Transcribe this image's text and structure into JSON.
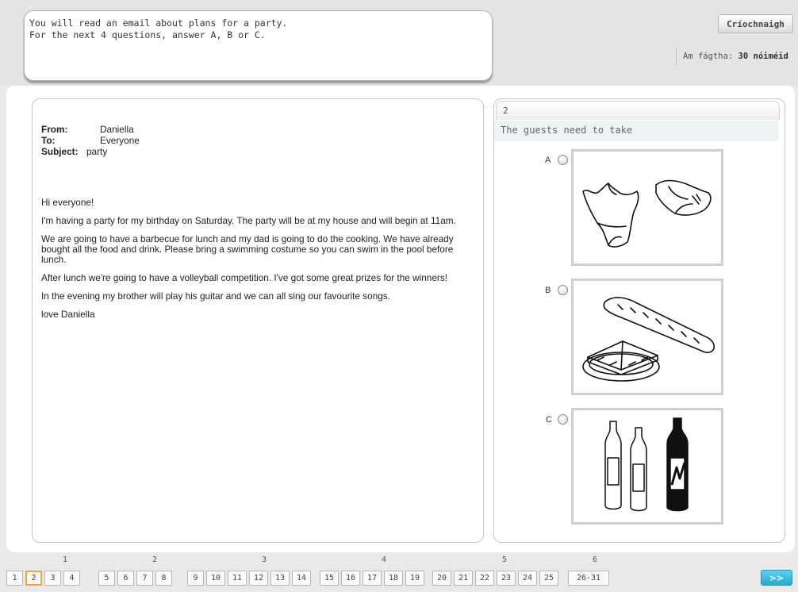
{
  "instructions": {
    "line1": "You will read an email about plans for a party.",
    "line2": "For the next 4 questions, answer A, B or C."
  },
  "header": {
    "finish_label": "Críochnaigh",
    "timer_label": "Am fágtha:",
    "timer_value": "30 nóiméid"
  },
  "email": {
    "from_label": "From:",
    "from_value": "Daniella",
    "to_label": "To:",
    "to_value": "Everyone",
    "subject_label": "Subject:",
    "subject_value": "party",
    "greeting": "Hi everyone!",
    "para1": "I'm having a party for my birthday on Saturday. The party will be at my house and will begin at 11am.",
    "para2": "We are going to have a barbecue for lunch and my dad is going to do the cooking. We have already bought all the food and drink. Please bring a swimming costume so you can swim in the pool before lunch.",
    "para3": "After lunch we're going to have a volleyball competition. I've got some great prizes for the winners!",
    "para4": "In the evening my brother will play his guitar and we can all sing our favourite songs.",
    "signoff": "love Daniella"
  },
  "question": {
    "number": "2",
    "stem": "The guests need to take",
    "options": [
      {
        "label": "A",
        "image": "swimming-costume"
      },
      {
        "label": "B",
        "image": "sandwiches-and-baguette"
      },
      {
        "label": "C",
        "image": "drink-bottles"
      }
    ]
  },
  "navigation": {
    "sections": [
      "1",
      "2",
      "3",
      "4",
      "5",
      "6"
    ],
    "buttons": [
      "1",
      "2",
      "3",
      "4",
      "5",
      "6",
      "7",
      "8",
      "9",
      "10",
      "11",
      "12",
      "13",
      "14",
      "15",
      "16",
      "17",
      "18",
      "19",
      "20",
      "21",
      "22",
      "23",
      "24",
      "25",
      "26-31"
    ],
    "current": "2",
    "next_label": ">>"
  },
  "colors": {
    "current_outline": "#f0a542",
    "next_button": "#3bb8dc"
  }
}
